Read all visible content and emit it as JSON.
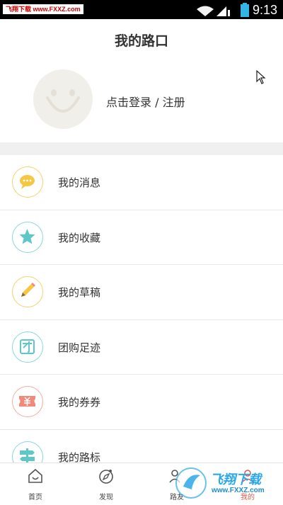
{
  "status_bar": {
    "watermark": "飞翔下载 www.FXXZ.com",
    "time": "9:13"
  },
  "header": {
    "title": "我的路口"
  },
  "profile": {
    "login_text": "点击登录 / 注册"
  },
  "menu": {
    "items": [
      {
        "label": "我的消息",
        "icon": "chat-bubble-icon",
        "color": "#f5c842"
      },
      {
        "label": "我的收藏",
        "icon": "star-icon",
        "color": "#5ec8c8"
      },
      {
        "label": "我的草稿",
        "icon": "pencil-icon",
        "color": "#f5c842"
      },
      {
        "label": "团购足迹",
        "icon": "group-buy-icon",
        "color": "#5ec8c8"
      },
      {
        "label": "我的券券",
        "icon": "coupon-icon",
        "color": "#f08a7a"
      },
      {
        "label": "我的路标",
        "icon": "signpost-icon",
        "color": "#5ec8c8"
      }
    ]
  },
  "bottom_nav": {
    "items": [
      {
        "label": "首页",
        "icon": "home-icon"
      },
      {
        "label": "发现",
        "icon": "compass-icon"
      },
      {
        "label": "路友",
        "icon": "friends-icon"
      },
      {
        "label": "我的",
        "icon": "profile-icon"
      }
    ]
  },
  "watermark_logo": {
    "text": "飞翔下载",
    "url": "www.FXXZ.com"
  }
}
